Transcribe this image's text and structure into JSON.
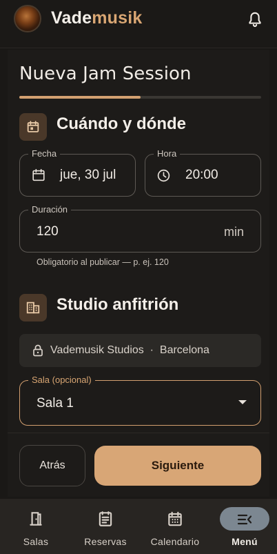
{
  "header": {
    "brand_part1": "Vade",
    "brand_part2": "musik"
  },
  "wizard": {
    "title": "Nueva Jam Session",
    "progress": 0.5
  },
  "when_where": {
    "title": "Cuándo y dónde",
    "date_label": "Fecha",
    "date_value": "jue, 30 jul",
    "time_label": "Hora",
    "time_value": "20:00",
    "duration_label": "Duración",
    "duration_value": "120",
    "duration_unit": "min",
    "duration_helper": "Obligatorio al publicar — p. ej. 120"
  },
  "studio": {
    "title": "Studio anfitrión",
    "studio_name": "Vademusik Studios",
    "separator": "·",
    "city": "Barcelona",
    "room_label": "Sala (opcional)",
    "room_value": "Sala 1"
  },
  "actions": {
    "back_label": "Atrás",
    "next_label": "Siguiente"
  },
  "bottom_nav": [
    {
      "label": "Salas",
      "icon": "door-icon"
    },
    {
      "label": "Reservas",
      "icon": "list-icon"
    },
    {
      "label": "Calendario",
      "icon": "calendar-icon"
    },
    {
      "label": "Menú",
      "icon": "menu-icon",
      "active": true
    }
  ],
  "colors": {
    "accent": "#d8a676",
    "background": "#1a1816",
    "surface": "#282522"
  }
}
